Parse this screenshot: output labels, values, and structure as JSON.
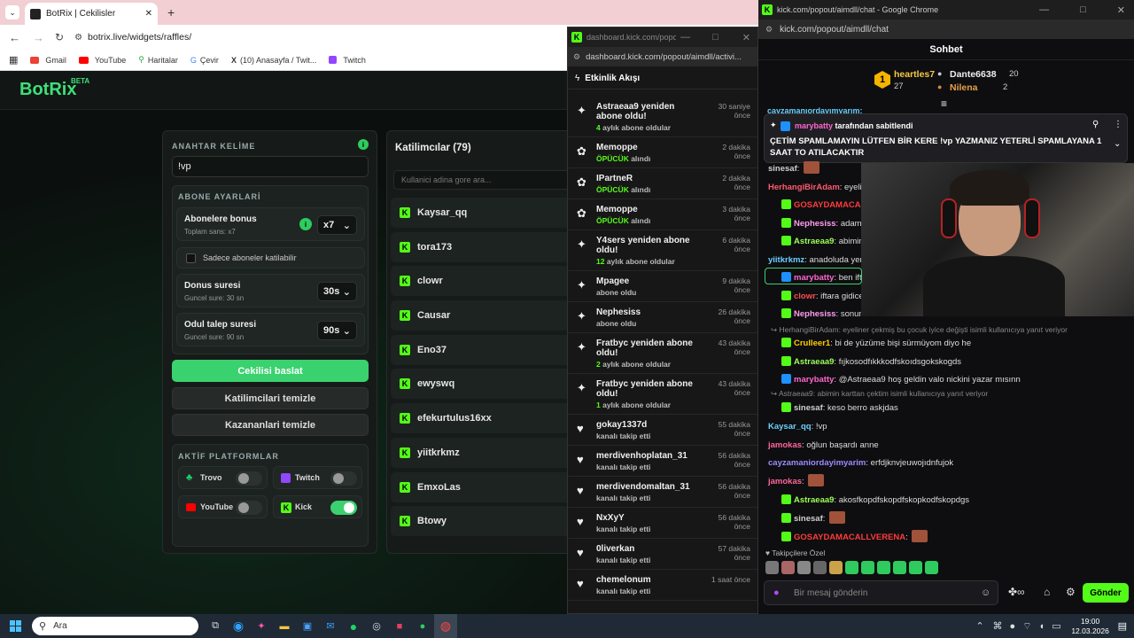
{
  "browser": {
    "tab_title": "BotRix | Cekilisler",
    "url": "botrix.live/widgets/raffles/",
    "bookmarks": [
      "Gmail",
      "YouTube",
      "Haritalar",
      "Çevir",
      "(10) Anasayfa / Twit...",
      "Twitch"
    ]
  },
  "botrix": {
    "logo": "BotRix",
    "beta": "BETA",
    "keyword_label": "ANAHTAR KELİME",
    "keyword_value": "!vp",
    "sub_settings_label": "ABONE AYARLARİ",
    "sub_bonus_title": "Abonelere bonus",
    "sub_bonus_sub": "Toplam sans: x7",
    "sub_bonus_value": "x7",
    "only_subs_label": "Sadece aboneler katilabilir",
    "duration_title": "Donus suresi",
    "duration_sub": "Guncel sure: 30 sn",
    "duration_value": "30s",
    "claim_title": "Odul talep suresi",
    "claim_sub": "Guncel sure: 90 sn",
    "claim_value": "90s",
    "start_button": "Cekilisi baslat",
    "clear_participants": "Katilimcilari temizle",
    "clear_winners": "Kazananlari temizle",
    "platforms_label": "AKTİF PLATFORMLAR",
    "platforms": [
      {
        "name": "Trovo",
        "on": false,
        "color": "#19d66b"
      },
      {
        "name": "Twitch",
        "on": false,
        "color": "#9146ff"
      },
      {
        "name": "YouTube",
        "on": false,
        "color": "#ff0000"
      },
      {
        "name": "Kick",
        "on": true,
        "color": "#53fc18"
      }
    ],
    "participants_title": "Katilimcılar (79)",
    "search_placeholder": "Kullanici adina gore ara...",
    "participants": [
      "Kaysar_qq",
      "tora173",
      "clowr",
      "Causar",
      "Eno37",
      "ewyswq",
      "efekurtulus16xx",
      "yiitkrkmz",
      "EmxoLas",
      "Btowy"
    ]
  },
  "dashboard": {
    "window_url": "dashboard.kick.com/popout...",
    "addr": "dashboard.kick.com/popout/aimdll/activi...",
    "title": "Etkinlik Akışı",
    "items": [
      {
        "icon": "sparkle",
        "title": "Astraeaa9 yeniden abone oldu!",
        "sub_bold": "4",
        "sub": " aylık abone oldular",
        "time": "30 saniye önce"
      },
      {
        "icon": "gift",
        "title": "Memoppe",
        "sub_bold": "ÖPÜCÜK",
        "sub": " alındı",
        "time": "2 dakika önce"
      },
      {
        "icon": "gift",
        "title": "IPartneR",
        "sub_bold": "ÖPÜCÜK",
        "sub": " alındı",
        "time": "2 dakika önce"
      },
      {
        "icon": "gift",
        "title": "Memoppe",
        "sub_bold": "ÖPÜCÜK",
        "sub": " alındı",
        "time": "3 dakika önce"
      },
      {
        "icon": "sparkle",
        "title": "Y4sers yeniden abone oldu!",
        "sub_bold": "12",
        "sub": " aylık abone oldular",
        "time": "6 dakika önce"
      },
      {
        "icon": "sparkle",
        "title": "Mpagee",
        "sub_bold": "",
        "sub": "abone oldu",
        "time": "9 dakika önce"
      },
      {
        "icon": "sparkle",
        "title": "Nephesiss",
        "sub_bold": "",
        "sub": "abone oldu",
        "time": "26 dakika önce"
      },
      {
        "icon": "sparkle",
        "title": "Fratbyc yeniden abone oldu!",
        "sub_bold": "2",
        "sub": " aylık abone oldular",
        "time": "43 dakika önce"
      },
      {
        "icon": "sparkle",
        "title": "Fratbyc yeniden abone oldu!",
        "sub_bold": "1",
        "sub": " aylık abone oldular",
        "time": "43 dakika önce"
      },
      {
        "icon": "heart",
        "title": "gokay1337d",
        "sub_bold": "",
        "sub": "kanalı takip etti",
        "time": "55 dakika önce"
      },
      {
        "icon": "heart",
        "title": "merdivenhoplatan_31",
        "sub_bold": "",
        "sub": "kanalı takip etti",
        "time": "56 dakika önce"
      },
      {
        "icon": "heart",
        "title": "merdivendomaltan_31",
        "sub_bold": "",
        "sub": "kanalı takip etti",
        "time": "56 dakika önce"
      },
      {
        "icon": "heart",
        "title": "NxXyY",
        "sub_bold": "",
        "sub": "kanalı takip etti",
        "time": "56 dakika önce"
      },
      {
        "icon": "heart",
        "title": "0liverkan",
        "sub_bold": "",
        "sub": "kanalı takip etti",
        "time": "57 dakika önce"
      },
      {
        "icon": "heart",
        "title": "chemelonum",
        "sub_bold": "",
        "sub": "kanalı takip etti",
        "time": "1 saat önce"
      }
    ]
  },
  "chat": {
    "window_title": "kick.com/popout/aimdll/chat - Google Chrome",
    "addr": "kick.com/popout/aimdll/chat",
    "title": "Sohbet",
    "top": [
      {
        "name": "heartles7",
        "count": "27"
      },
      {
        "name": "Dante6638",
        "count": "20"
      },
      {
        "name": "Nilena",
        "count": "2"
      }
    ],
    "pinned_by": "marybatty",
    "pinned_by_suffix": " tarafından sabitlendi",
    "pinned_text": "ÇETİM SPAMLAMAYIN LÜTFEN BİR KERE !vp YAZMANIZ YETERLİ SPAMLAYANA 1 SAAT TO ATILACAKTIR",
    "cut_user": "cayzamanıordayımyarım:",
    "messages": [
      {
        "user": "sinesaf",
        "color": "#cfcfcf",
        "text": "",
        "emote": true,
        "badge": ""
      },
      {
        "user": "HerhangiBirAdam",
        "color": "#ff5a6e",
        "text": "eyeliner",
        "badge": ""
      },
      {
        "user": "GOSAYDAMACALLVERE",
        "color": "#ff3b3b",
        "text": "",
        "badge": "#53fc18"
      },
      {
        "user": "Nephesiss",
        "color": "#ff9cf0",
        "text": "adam delle",
        "badge": "#53fc18"
      },
      {
        "user": "Astraeaa9",
        "color": "#9dff5a",
        "text": "abimin kar",
        "badge": "#53fc18"
      },
      {
        "user": "yiitkrkmz",
        "color": "#6ad0ff",
        "text": "anadoluda yen",
        "badge": ""
      },
      {
        "user": "marybatty",
        "color": "#ff66cc",
        "text": "ben ift",
        "badge": "#1e90ff"
      },
      {
        "user": "clowr",
        "color": "#ff4d4d",
        "text": "iftara gidicem a",
        "badge": "#53fc18"
      },
      {
        "user": "Nephesiss",
        "color": "#ff9cf0",
        "text": "sonunda b",
        "badge": "#53fc18"
      }
    ],
    "reply1": "HerhangiBirAdam: eyeliner çekmiş bu çocuk iyice değişti isimli kullanıcıya yanıt veriyor",
    "messages2": [
      {
        "user": "Crulleer1",
        "color": "#ffcc00",
        "text": "bi de yüzüme bişi sürmüyom diyo he",
        "badge": "#53fc18"
      },
      {
        "user": "Astraeaa9",
        "color": "#9dff5a",
        "text": "fıjkosodfıkkkodfskoıdsgokskogds",
        "badge": "#53fc18"
      },
      {
        "user": "marybatty",
        "color": "#ff66cc",
        "text": "@Astraeaa9 hoş geldin valo nickini yazar mısınn",
        "badge": "#1e90ff"
      }
    ],
    "reply2": "Astraeaa9: abimin karttan çektim isimli kullanıcıya yanıt veriyor",
    "messages3": [
      {
        "user": "sinesaf",
        "color": "#cfcfcf",
        "text": "keso berro askjdas",
        "badge": "#53fc18"
      },
      {
        "user": "Kaysar_qq",
        "color": "#6ad0ff",
        "text": "!vp",
        "badge": ""
      },
      {
        "user": "jamokas",
        "color": "#ff6699",
        "text": "oğlun başardı anne",
        "badge": ""
      },
      {
        "user": "cayzamaniordayimyarim",
        "color": "#9b8cff",
        "text": "erfdjknvjeuwojıdnfujok",
        "badge": ""
      },
      {
        "user": "jamokas",
        "color": "#ff6699",
        "text": "",
        "badge": "",
        "emote": true
      },
      {
        "user": "Astraeaa9",
        "color": "#9dff5a",
        "text": "akosfkopdfskopdfskopkodfskopdgs",
        "badge": "#53fc18"
      },
      {
        "user": "sinesaf",
        "color": "#cfcfcf",
        "text": "",
        "badge": "#53fc18",
        "emote": true
      },
      {
        "user": "GOSAYDAMACALLVERENA",
        "color": "#ff3b3b",
        "text": "",
        "badge": "#53fc18",
        "emote": true
      }
    ],
    "followers_label": "Takipçilere Özel",
    "input_placeholder": "Bir mesaj gönderin",
    "send_button": "Gönder"
  },
  "taskbar": {
    "search": "Ara",
    "time": "19:00",
    "date": "12.03.2026"
  }
}
